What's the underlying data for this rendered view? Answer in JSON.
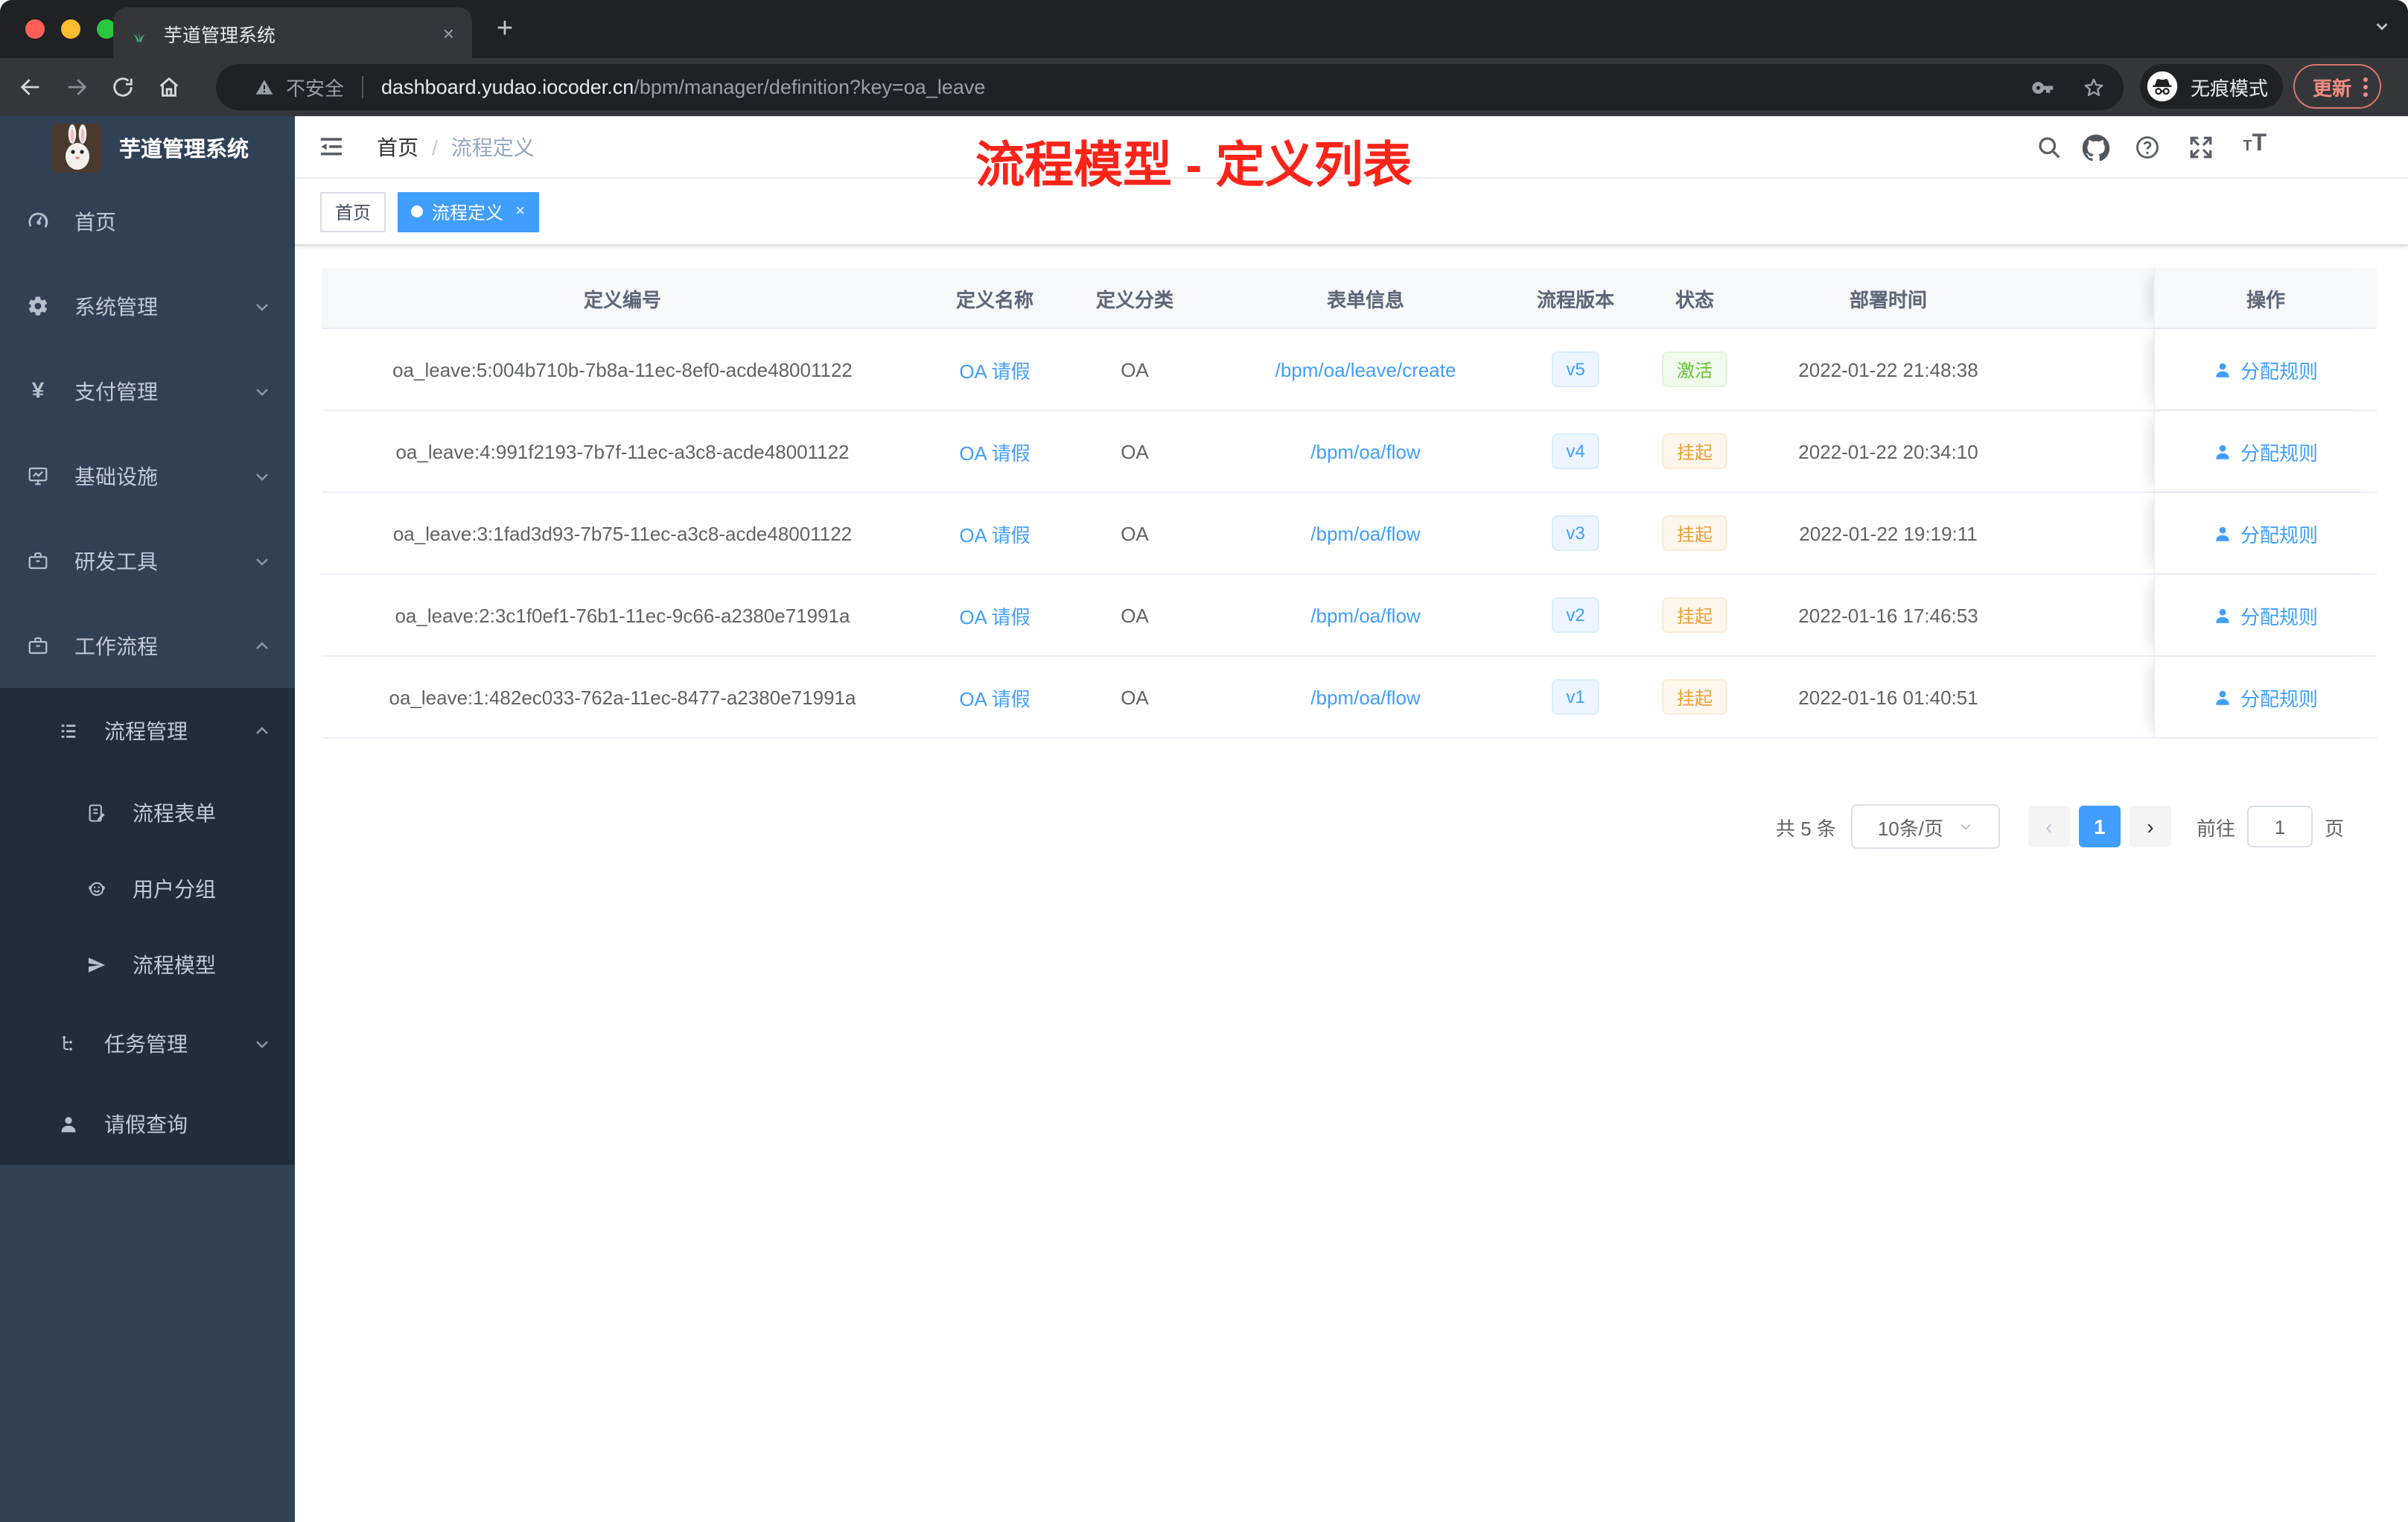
{
  "browser": {
    "tab": {
      "title": "芋道管理系统",
      "close": "×"
    },
    "new_tab": "+",
    "address": {
      "warning_label": "不安全",
      "host": "dashboard.yudao.iocoder.cn",
      "path": "/bpm/manager/definition?key=oa_leave"
    },
    "incognito_label": "无痕模式",
    "update_label": "更新"
  },
  "sidebar": {
    "logo_title": "芋道管理系统",
    "menu": [
      {
        "label": "首页"
      },
      {
        "label": "系统管理"
      },
      {
        "label": "支付管理"
      },
      {
        "label": "基础设施"
      },
      {
        "label": "研发工具"
      },
      {
        "label": "工作流程"
      }
    ],
    "submenu": [
      {
        "label": "流程管理"
      },
      {
        "label": "流程表单"
      },
      {
        "label": "用户分组"
      },
      {
        "label": "流程模型"
      },
      {
        "label": "任务管理"
      },
      {
        "label": "请假查询"
      }
    ]
  },
  "header": {
    "breadcrumb": {
      "home": "首页",
      "separator": "/",
      "current": "流程定义"
    },
    "annotation": "流程模型 - 定义列表",
    "font_icon_label_small": "T",
    "font_icon_label_big": "T"
  },
  "tags": {
    "home": "首页",
    "active": "流程定义",
    "close": "×"
  },
  "table": {
    "columns": [
      "定义编号",
      "定义名称",
      "定义分类",
      "表单信息",
      "流程版本",
      "状态",
      "部署时间",
      "操作"
    ],
    "rows": [
      {
        "id": "oa_leave:5:004b710b-7b8a-11ec-8ef0-acde48001122",
        "name": "OA 请假",
        "category": "OA",
        "form": "/bpm/oa/leave/create",
        "version": "v5",
        "status": "激活",
        "deploy_time": "2022-01-22 21:48:38",
        "action": "分配规则"
      },
      {
        "id": "oa_leave:4:991f2193-7b7f-11ec-a3c8-acde48001122",
        "name": "OA 请假",
        "category": "OA",
        "form": "/bpm/oa/flow",
        "version": "v4",
        "status": "挂起",
        "deploy_time": "2022-01-22 20:34:10",
        "action": "分配规则"
      },
      {
        "id": "oa_leave:3:1fad3d93-7b75-11ec-a3c8-acde48001122",
        "name": "OA 请假",
        "category": "OA",
        "form": "/bpm/oa/flow",
        "version": "v3",
        "status": "挂起",
        "deploy_time": "2022-01-22 19:19:11",
        "action": "分配规则"
      },
      {
        "id": "oa_leave:2:3c1f0ef1-76b1-11ec-9c66-a2380e71991a",
        "name": "OA 请假",
        "category": "OA",
        "form": "/bpm/oa/flow",
        "version": "v2",
        "status": "挂起",
        "deploy_time": "2022-01-16 17:46:53",
        "action": "分配规则"
      },
      {
        "id": "oa_leave:1:482ec033-762a-11ec-8477-a2380e71991a",
        "name": "OA 请假",
        "category": "OA",
        "form": "/bpm/oa/flow",
        "version": "v1",
        "status": "挂起",
        "deploy_time": "2022-01-16 01:40:51",
        "action": "分配规则"
      }
    ]
  },
  "pagination": {
    "total": "共 5 条",
    "page_size": "10条/页",
    "prev": "‹",
    "current_page": "1",
    "next": "›",
    "goto_label": "前往",
    "goto_value": "1",
    "unit_label": "页"
  },
  "colors": {
    "accent": "#409eff",
    "success": "#67c23a",
    "warning": "#e6a23c",
    "annotation_red": "#fc2419",
    "sidebar_bg": "#304156",
    "submenu_bg": "#1f2d3d",
    "tag_active": "#409eff"
  }
}
